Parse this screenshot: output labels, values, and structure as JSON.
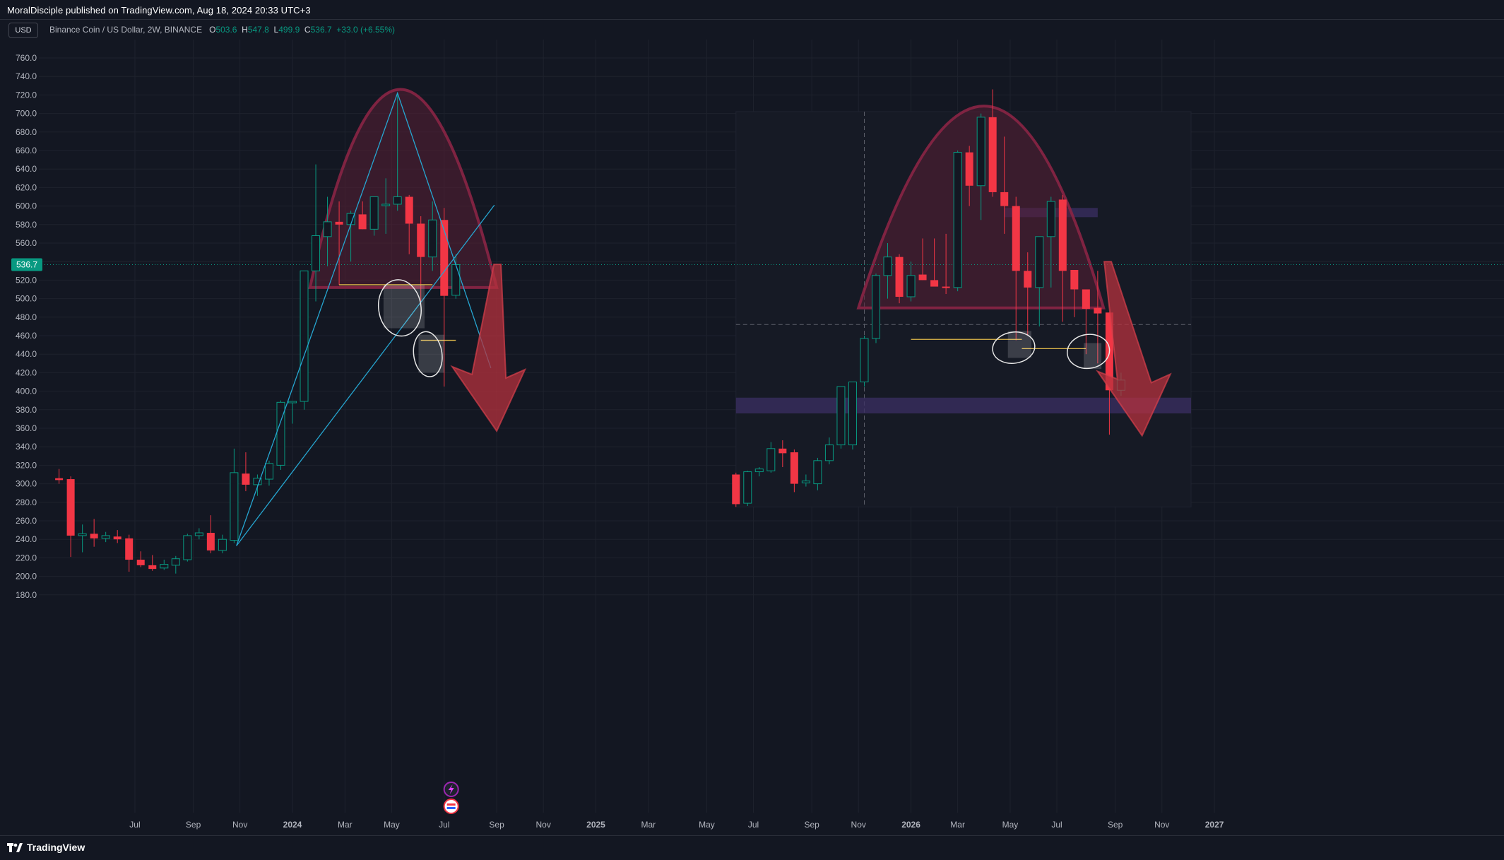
{
  "header": {
    "publish_text": "MoralDisciple published on TradingView.com, Aug 18, 2024 20:33 UTC+3",
    "currency_button": "USD",
    "symbol": "Binance Coin / US Dollar, 2W, BINANCE",
    "ohlc": {
      "o_label": "O",
      "o_value": "503.6",
      "h_label": "H",
      "h_value": "547.8",
      "l_label": "L",
      "l_value": "499.9",
      "c_label": "C",
      "c_value": "536.7",
      "change": "+33.0 (+6.55%)"
    }
  },
  "footer": {
    "brand": "TradingView"
  },
  "colors": {
    "background": "#131722",
    "grid": "#1e222d",
    "axis_text": "#b2b5be",
    "up": "#089981",
    "down": "#f23645",
    "price_tag": "#089981",
    "arch_fill": "#5a1f35",
    "arch_stroke": "#8a2545",
    "trendline": "#26a6d1",
    "support_line": "#e0b94a",
    "zone": "#3b2f63",
    "arrow": "#b5313e"
  },
  "chart_data": {
    "type": "candlestick",
    "y_axis": {
      "ylim": [
        170,
        770
      ],
      "ticks": [
        "760.0",
        "740.0",
        "720.0",
        "700.0",
        "680.0",
        "660.0",
        "640.0",
        "620.0",
        "600.0",
        "580.0",
        "560.0",
        "540.0",
        "520.0",
        "500.0",
        "480.0",
        "460.0",
        "440.0",
        "420.0",
        "400.0",
        "380.0",
        "360.0",
        "340.0",
        "320.0",
        "300.0",
        "280.0",
        "260.0",
        "240.0",
        "220.0",
        "200.0",
        "180.0"
      ],
      "current_price": 536.7,
      "current_price_label": "536.7"
    },
    "x_axis": {
      "labels": [
        "Jul",
        "Sep",
        "Nov",
        "2024",
        "Mar",
        "May",
        "Jul",
        "Sep",
        "Nov",
        "2025",
        "Mar",
        "May",
        "Jul",
        "Sep",
        "Nov",
        "2026",
        "Mar",
        "May",
        "Jul",
        "Sep",
        "Nov",
        "2027"
      ],
      "label_index": [
        6.5,
        11.5,
        15.5,
        20,
        24.5,
        28.5,
        33,
        37.5,
        41.5,
        46,
        50.5,
        55.5,
        59.5,
        64.5,
        68.5,
        73,
        77,
        81.5,
        85.5,
        90.5,
        94.5,
        99
      ]
    },
    "candles_actual": [
      {
        "i": 0,
        "o": 306,
        "h": 316,
        "l": 300,
        "c": 304
      },
      {
        "i": 1,
        "o": 305,
        "h": 308,
        "l": 221,
        "c": 244
      },
      {
        "i": 2,
        "o": 244,
        "h": 256,
        "l": 226,
        "c": 246
      },
      {
        "i": 3,
        "o": 246,
        "h": 262,
        "l": 232,
        "c": 241
      },
      {
        "i": 4,
        "o": 241,
        "h": 248,
        "l": 237,
        "c": 244
      },
      {
        "i": 5,
        "o": 243,
        "h": 250,
        "l": 236,
        "c": 240
      },
      {
        "i": 6,
        "o": 241,
        "h": 245,
        "l": 205,
        "c": 218
      },
      {
        "i": 7,
        "o": 218,
        "h": 227,
        "l": 210,
        "c": 212
      },
      {
        "i": 8,
        "o": 212,
        "h": 223,
        "l": 206,
        "c": 208
      },
      {
        "i": 9,
        "o": 209,
        "h": 218,
        "l": 207,
        "c": 213
      },
      {
        "i": 10,
        "o": 212,
        "h": 222,
        "l": 203,
        "c": 219
      },
      {
        "i": 11,
        "o": 218,
        "h": 246,
        "l": 216,
        "c": 244
      },
      {
        "i": 12,
        "o": 244,
        "h": 252,
        "l": 240,
        "c": 247
      },
      {
        "i": 13,
        "o": 247,
        "h": 266,
        "l": 225,
        "c": 228
      },
      {
        "i": 14,
        "o": 228,
        "h": 245,
        "l": 225,
        "c": 240
      },
      {
        "i": 15,
        "o": 239,
        "h": 338,
        "l": 236,
        "c": 312
      },
      {
        "i": 16,
        "o": 311,
        "h": 334,
        "l": 292,
        "c": 299
      },
      {
        "i": 17,
        "o": 299,
        "h": 310,
        "l": 287,
        "c": 306
      },
      {
        "i": 18,
        "o": 305,
        "h": 325,
        "l": 298,
        "c": 322
      },
      {
        "i": 19,
        "o": 320,
        "h": 390,
        "l": 315,
        "c": 388
      },
      {
        "i": 20,
        "o": 389,
        "h": 388,
        "l": 365,
        "c": 389
      },
      {
        "i": 21,
        "o": 389,
        "h": 530,
        "l": 380,
        "c": 530
      },
      {
        "i": 22,
        "o": 530,
        "h": 645,
        "l": 497,
        "c": 568
      },
      {
        "i": 23,
        "o": 567,
        "h": 610,
        "l": 535,
        "c": 583
      },
      {
        "i": 24,
        "o": 583,
        "h": 605,
        "l": 515,
        "c": 580
      },
      {
        "i": 25,
        "o": 580,
        "h": 595,
        "l": 540,
        "c": 592
      },
      {
        "i": 26,
        "o": 591,
        "h": 605,
        "l": 575,
        "c": 575
      },
      {
        "i": 27,
        "o": 575,
        "h": 605,
        "l": 568,
        "c": 610
      },
      {
        "i": 28,
        "o": 602,
        "h": 630,
        "l": 570,
        "c": 602
      },
      {
        "i": 29,
        "o": 602,
        "h": 722,
        "l": 595,
        "c": 610
      },
      {
        "i": 30,
        "o": 610,
        "h": 612,
        "l": 548,
        "c": 581
      },
      {
        "i": 31,
        "o": 581,
        "h": 589,
        "l": 491,
        "c": 545
      },
      {
        "i": 32,
        "o": 545,
        "h": 605,
        "l": 530,
        "c": 585
      },
      {
        "i": 33,
        "o": 585,
        "h": 598,
        "l": 405,
        "c": 503
      },
      {
        "i": 34,
        "o": 503.6,
        "h": 547.8,
        "l": 499.9,
        "c": 536.7
      }
    ],
    "candles_fractal": [
      {
        "i": 58,
        "o": 310,
        "h": 312,
        "l": 275,
        "c": 278
      },
      {
        "i": 59,
        "o": 279,
        "h": 314,
        "l": 276,
        "c": 313
      },
      {
        "i": 60,
        "o": 313,
        "h": 318,
        "l": 308,
        "c": 316
      },
      {
        "i": 61,
        "o": 314,
        "h": 345,
        "l": 312,
        "c": 338
      },
      {
        "i": 62,
        "o": 338,
        "h": 347,
        "l": 318,
        "c": 333
      },
      {
        "i": 63,
        "o": 334,
        "h": 337,
        "l": 291,
        "c": 300
      },
      {
        "i": 64,
        "o": 301,
        "h": 310,
        "l": 297,
        "c": 303
      },
      {
        "i": 65,
        "o": 300,
        "h": 328,
        "l": 293,
        "c": 325
      },
      {
        "i": 66,
        "o": 325,
        "h": 350,
        "l": 321,
        "c": 342
      },
      {
        "i": 67,
        "o": 342,
        "h": 385,
        "l": 338,
        "c": 405
      },
      {
        "i": 68,
        "o": 342,
        "h": 410,
        "l": 337,
        "c": 410
      },
      {
        "i": 69,
        "o": 410,
        "h": 460,
        "l": 405,
        "c": 457
      },
      {
        "i": 70,
        "o": 457,
        "h": 527,
        "l": 452,
        "c": 525
      },
      {
        "i": 71,
        "o": 525,
        "h": 560,
        "l": 500,
        "c": 545
      },
      {
        "i": 72,
        "o": 545,
        "h": 548,
        "l": 495,
        "c": 502
      },
      {
        "i": 73,
        "o": 502,
        "h": 540,
        "l": 497,
        "c": 525
      },
      {
        "i": 74,
        "o": 526,
        "h": 565,
        "l": 520,
        "c": 520
      },
      {
        "i": 75,
        "o": 520,
        "h": 565,
        "l": 515,
        "c": 513
      },
      {
        "i": 76,
        "o": 513,
        "h": 570,
        "l": 505,
        "c": 512
      },
      {
        "i": 77,
        "o": 512,
        "h": 660,
        "l": 508,
        "c": 658
      },
      {
        "i": 78,
        "o": 658,
        "h": 665,
        "l": 600,
        "c": 622
      },
      {
        "i": 79,
        "o": 622,
        "h": 700,
        "l": 585,
        "c": 696
      },
      {
        "i": 80,
        "o": 696,
        "h": 726,
        "l": 610,
        "c": 615
      },
      {
        "i": 81,
        "o": 615,
        "h": 675,
        "l": 570,
        "c": 600
      },
      {
        "i": 82,
        "o": 600,
        "h": 610,
        "l": 455,
        "c": 530
      },
      {
        "i": 83,
        "o": 530,
        "h": 550,
        "l": 460,
        "c": 512
      },
      {
        "i": 84,
        "o": 512,
        "h": 562,
        "l": 470,
        "c": 567
      },
      {
        "i": 85,
        "o": 567,
        "h": 610,
        "l": 512,
        "c": 605
      },
      {
        "i": 86,
        "o": 607,
        "h": 612,
        "l": 475,
        "c": 530
      },
      {
        "i": 87,
        "o": 531,
        "h": 531,
        "l": 480,
        "c": 510
      },
      {
        "i": 88,
        "o": 510,
        "h": 510,
        "l": 440,
        "c": 489
      },
      {
        "i": 89,
        "o": 490,
        "h": 530,
        "l": 430,
        "c": 484
      },
      {
        "i": 90,
        "o": 485,
        "h": 485,
        "l": 353,
        "c": 401
      },
      {
        "i": 91,
        "o": 401,
        "h": 420,
        "l": 395,
        "c": 412
      }
    ],
    "annotations": {
      "actual_arch": {
        "left_i": 21.5,
        "right_i": 37.5,
        "apex_i": 29,
        "top": 726,
        "base": 512
      },
      "actual_wedge_trendline": [
        [
          15.2,
          233
        ],
        [
          29,
          722
        ],
        [
          37,
          425
        ]
      ],
      "actual_rising_trendline": [
        [
          15.2,
          233
        ],
        [
          37.3,
          601
        ]
      ],
      "actual_support_lines": [
        {
          "from_i": 24,
          "to_i": 32,
          "y": 515
        },
        {
          "from_i": 31,
          "to_i": 34,
          "y": 455
        }
      ],
      "actual_bearish_arrow": {
        "tail_i": 37.5,
        "tail_y": 537,
        "tip_i": 37.2,
        "tip_y": 357
      },
      "fractal_box": {
        "left_i": 58,
        "right_i": 97,
        "top": 702,
        "bottom": 275
      },
      "fractal_arch": {
        "left_i": 68.5,
        "right_i": 89.5,
        "apex_i": 79.5,
        "top": 708,
        "base": 490
      },
      "fractal_support_lines": [
        {
          "from_i": 73,
          "to_i": 82.5,
          "y": 456
        },
        {
          "from_i": 82.5,
          "to_i": 88,
          "y": 446
        }
      ],
      "fractal_zones": [
        {
          "from_i": 58,
          "to_i": 97,
          "y1": 376,
          "y2": 393
        },
        {
          "from_i": 81,
          "to_i": 89,
          "y1": 588,
          "y2": 598
        }
      ],
      "fractal_dashed_h": 472,
      "fractal_dashed_v_i": 69,
      "fractal_bearish_arrow": {
        "tail_i": 89.8,
        "tail_y": 540,
        "tip_i": 92.5,
        "tip_y": 352
      }
    }
  }
}
